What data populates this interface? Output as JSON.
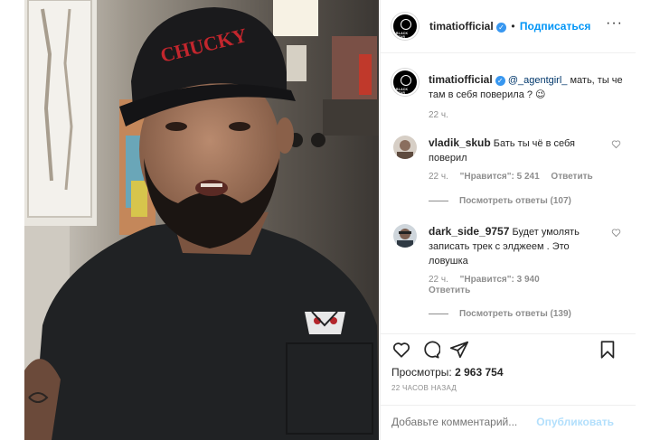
{
  "post": {
    "username": "timatiofficial",
    "follow_label": "Подписаться",
    "more_icon": "ellipsis-icon"
  },
  "caption": {
    "username": "timatiofficial",
    "mention": "@_agentgirl_",
    "text": " мать, ты че там в себя поверила ? 😉",
    "time": "22 ч."
  },
  "comments": [
    {
      "username": "vladik_skub",
      "text": " Бать ты чё в себя поверил",
      "time": "22 ч.",
      "likes": "\"Нравится\": 5 241",
      "reply_label": "Ответить",
      "replies_label": "Посмотреть ответы (107)"
    },
    {
      "username": "dark_side_9757",
      "text": " Будет умолять записать трек с элджеем . Это ловушка",
      "time": "22 ч.",
      "likes": "\"Нравится\": 3 940",
      "reply_label": "Ответить",
      "replies_label": "Посмотреть ответы (139)"
    }
  ],
  "stats": {
    "views_label": "Просмотры:",
    "views_value": "2 963 754",
    "posted_ago": "22 ЧАСОВ НАЗАД"
  },
  "add_comment": {
    "placeholder": "Добавьте комментарий...",
    "post_label": "Опубликовать"
  },
  "media": {
    "cap_text": "CHUCKY"
  },
  "colors": {
    "accent": "#0095f6",
    "verified": "#3897f0",
    "muted": "#8e8e8e"
  }
}
